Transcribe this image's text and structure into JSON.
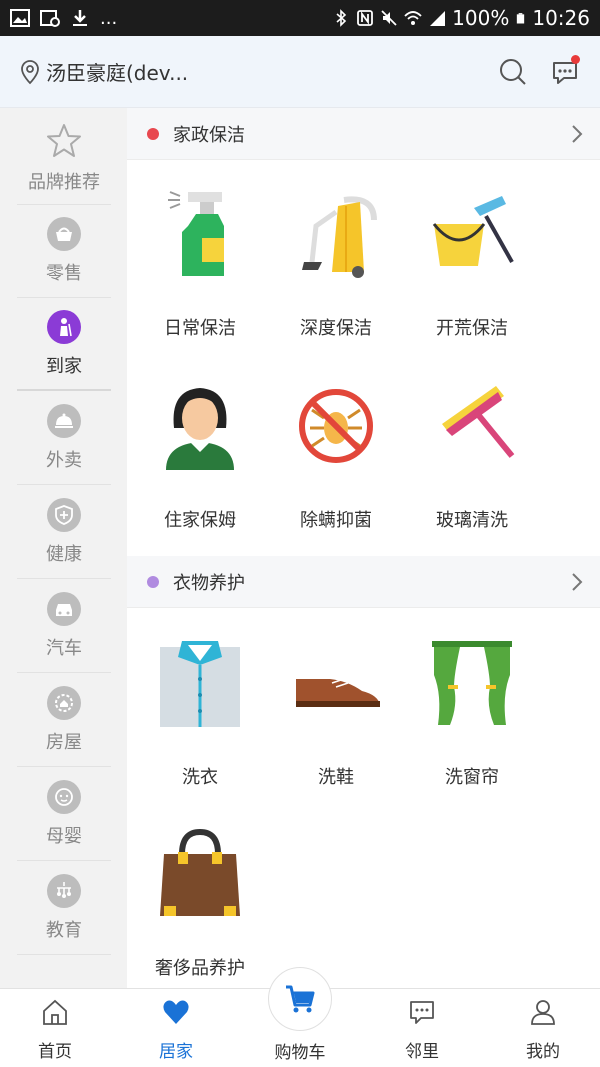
{
  "status_bar": {
    "battery": "100%",
    "time": "10:26",
    "more": "..."
  },
  "header": {
    "location": "汤臣豪庭(dev..."
  },
  "sidebar": {
    "items": [
      {
        "label": "品牌推荐",
        "icon": "star-icon"
      },
      {
        "label": "零售",
        "icon": "basket-icon"
      },
      {
        "label": "到家",
        "icon": "cleaning-person-icon"
      },
      {
        "label": "外卖",
        "icon": "cloche-icon"
      },
      {
        "label": "健康",
        "icon": "shield-plus-icon"
      },
      {
        "label": "汽车",
        "icon": "car-icon"
      },
      {
        "label": "房屋",
        "icon": "house-gear-icon"
      },
      {
        "label": "母婴",
        "icon": "baby-face-icon"
      },
      {
        "label": "教育",
        "icon": "mobile-toy-icon"
      }
    ],
    "active_index": 2
  },
  "sections": [
    {
      "title": "家政保洁",
      "dot_color": "#e8484f",
      "services": [
        {
          "label": "日常保洁",
          "icon": "spray-bottle-icon"
        },
        {
          "label": "深度保洁",
          "icon": "vacuum-cleaner-icon"
        },
        {
          "label": "开荒保洁",
          "icon": "bucket-squeegee-icon"
        },
        {
          "label": "住家保姆",
          "icon": "nanny-icon"
        },
        {
          "label": "除螨抑菌",
          "icon": "no-mite-icon"
        },
        {
          "label": "玻璃清洗",
          "icon": "window-squeegee-icon"
        }
      ]
    },
    {
      "title": "衣物养护",
      "dot_color": "#b08be0",
      "services": [
        {
          "label": "洗衣",
          "icon": "shirt-icon"
        },
        {
          "label": "洗鞋",
          "icon": "shoe-icon"
        },
        {
          "label": "洗窗帘",
          "icon": "curtain-icon"
        },
        {
          "label": "奢侈品养护",
          "icon": "handbag-icon"
        }
      ]
    }
  ],
  "bottom_nav": {
    "items": [
      {
        "label": "首页",
        "icon": "home-icon"
      },
      {
        "label": "居家",
        "icon": "heart-icon"
      },
      {
        "label": "购物车",
        "icon": "cart-icon"
      },
      {
        "label": "邻里",
        "icon": "chat-icon"
      },
      {
        "label": "我的",
        "icon": "person-icon"
      }
    ],
    "active_index": 1
  },
  "colors": {
    "accent_blue": "#1a72d6",
    "active_purple": "#8b3bd6"
  }
}
